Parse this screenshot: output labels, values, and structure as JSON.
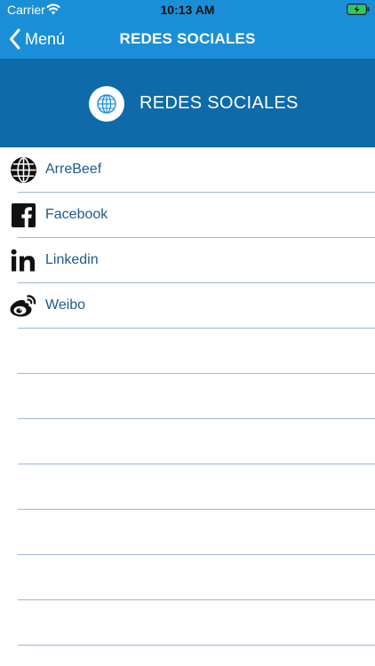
{
  "status_bar": {
    "carrier": "Carrier",
    "time": "10:13 AM"
  },
  "nav": {
    "back_label": "Menú",
    "title": "REDES SOCIALES"
  },
  "banner": {
    "title": "REDES SOCIALES",
    "icon": "globe-icon"
  },
  "social_links": [
    {
      "label": "ArreBeef",
      "icon": "globe-icon"
    },
    {
      "label": "Facebook",
      "icon": "facebook-icon"
    },
    {
      "label": "Linkedin",
      "icon": "linkedin-icon"
    },
    {
      "label": "Weibo",
      "icon": "weibo-icon"
    }
  ],
  "colors": {
    "nav_blue": "#1a8fd8",
    "banner_blue": "#0e6aa8",
    "link_text": "#1f5a8e",
    "separator": "#9db6d4",
    "battery_green": "#34c759"
  }
}
